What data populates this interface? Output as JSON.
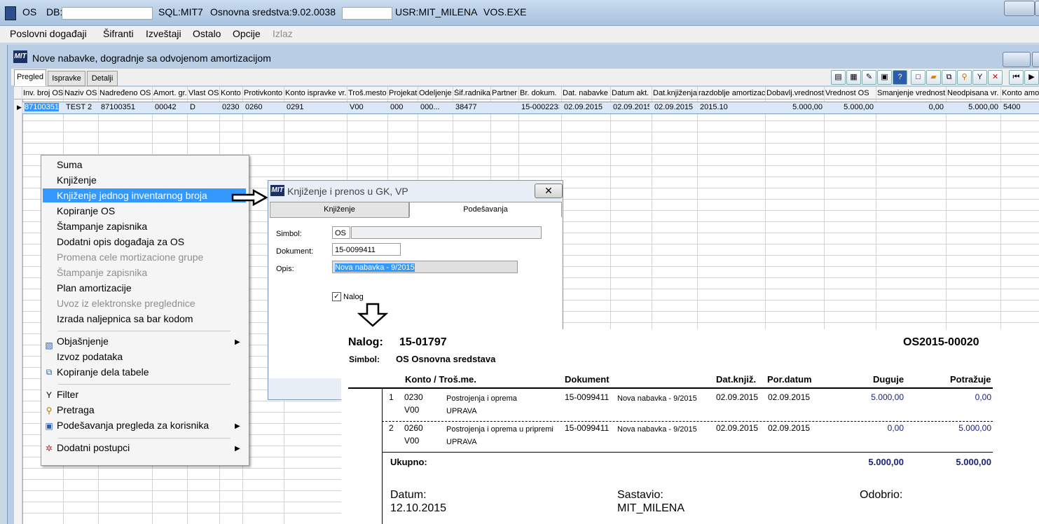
{
  "titlebar": {
    "app": "OS",
    "db_label": "DB:",
    "sql": "SQL:MIT7",
    "version": "Osnovna sredstva:9.02.0038",
    "user": "USR:MIT_MILENA",
    "exe": "VOS.EXE"
  },
  "menu": [
    "Poslovni događaji",
    "Šifranti",
    "Izveštaji",
    "Ostalo",
    "Opcije",
    "Izlaz"
  ],
  "window": {
    "logo": "MIT",
    "title": "Nove nabavke, dogradnje sa odvojenom amortizacijom"
  },
  "tabs": [
    "Pregled",
    "Ispravke",
    "Detalji"
  ],
  "grid": {
    "columns": [
      "Inv. broj OS",
      "Naziv OS",
      "Nadređeno OS",
      "Amort. gr.",
      "Vlast OS",
      "Konto",
      "Protivkonto",
      "Konto ispravke vr.",
      "Troš.mesto",
      "Projekat",
      "Odeljenje",
      "Šif.radnika",
      "Partner",
      "Br. dokum.",
      "Dat. nabavke",
      "Datum akt.",
      "Dat.knjiženja",
      "razdoblje amortizac",
      "Dobavlj.vrednost",
      "Vrednost OS",
      "Smanjenje vrednosti",
      "Neodpisana vr.",
      "Konto amo"
    ],
    "row": [
      "87100351",
      "TEST 2",
      "87100351",
      "00042",
      "D",
      "0230",
      "0260",
      "0291",
      "V00",
      "000",
      "000...",
      "38477",
      "",
      "15-0002233",
      "02.09.2015",
      "02.09.2015",
      "02.09.2015",
      "2015.10",
      "5.000,00",
      "5.000,00",
      "0,00",
      "5.000,00",
      "5400"
    ]
  },
  "context_menu": {
    "items": [
      {
        "label": "Suma",
        "disabled": false
      },
      {
        "label": "Knjiženje",
        "disabled": false
      },
      {
        "label": "Knjiženje jednog inventarnog broja",
        "disabled": false,
        "highlighted": true
      },
      {
        "label": "Kopiranje OS",
        "disabled": false
      },
      {
        "label": "Štampanje zapisnika",
        "disabled": false
      },
      {
        "label": "Dodatni opis događaja za OS",
        "disabled": false
      },
      {
        "label": "Promena cele mortizacione grupe",
        "disabled": true
      },
      {
        "label": "Štampanje zapisnika",
        "disabled": true
      },
      {
        "label": "Plan amortizacije",
        "disabled": false
      },
      {
        "label": "Uvoz iz elektronske preglednice",
        "disabled": true
      },
      {
        "label": "Izrada naljepnica sa bar kodom",
        "disabled": false
      },
      {
        "label": "Objašnjenje",
        "disabled": false,
        "submenu": true,
        "icon": "help-icon"
      },
      {
        "label": "Izvoz podataka",
        "disabled": false
      },
      {
        "label": "Kopiranje dela tabele",
        "disabled": false,
        "icon": "copy-icon"
      },
      {
        "label": "Filter",
        "disabled": false,
        "icon": "filter-icon"
      },
      {
        "label": "Pretraga",
        "disabled": false,
        "icon": "search-icon"
      },
      {
        "label": "Podešavanja pregleda za korisnika",
        "disabled": false,
        "submenu": true,
        "icon": "settings-icon"
      },
      {
        "label": "Dodatni postupci",
        "disabled": false,
        "submenu": true,
        "icon": "gear-icon"
      }
    ]
  },
  "dialog": {
    "logo": "MIT",
    "title": "Knjiženje i prenos u GK, VP",
    "tabs": [
      "Knjiženje",
      "Podešavanja"
    ],
    "simbol_label": "Simbol:",
    "simbol_value": "OS",
    "dokument_label": "Dokument:",
    "dokument_value": "15-0099411",
    "opis_label": "Opis:",
    "opis_value": "Nova nabavka - 9/2015",
    "nalog_label": "Nalog",
    "nalog_checked": true
  },
  "report": {
    "nalog_label": "Nalog:",
    "nalog_number": "15-01797",
    "doc_code": "OS2015-00020",
    "simbol_label": "Simbol:",
    "simbol_value": "OS  Osnovna sredstava",
    "headers": {
      "konto": "Konto  /  Troš.me.",
      "dokument": "Dokument",
      "dat_knjiz": "Dat.knjiž.",
      "por_datum": "Por.datum",
      "duguje": "Duguje",
      "potrazuje": "Potražuje"
    },
    "rows": [
      {
        "no": "1",
        "konto": "0230",
        "tros": "V00",
        "desc": "Postrojenja i oprema",
        "desc2": "UPRAVA",
        "doc": "15-0099411",
        "doc_desc": "Nova nabavka - 9/2015",
        "dat": "02.09.2015",
        "por": "02.09.2015",
        "duguje": "5.000,00",
        "potrazuje": "0,00"
      },
      {
        "no": "2",
        "konto": "0260",
        "tros": "V00",
        "desc": "Postrojenja i oprema u pripremi",
        "desc2": "UPRAVA",
        "doc": "15-0099411",
        "doc_desc": "Nova nabavka - 9/2015",
        "dat": "02.09.2015",
        "por": "02.09.2015",
        "duguje": "0,00",
        "potrazuje": "5.000,00"
      }
    ],
    "total_label": "Ukupno:",
    "total_duguje": "5.000,00",
    "total_potrazuje": "5.000,00",
    "datum_label": "Datum:",
    "datum_value": "12.10.2015",
    "sastavio_label": "Sastavio:",
    "sastavio_value": "MIT_MILENA",
    "odobrio_label": "Odobrio:"
  }
}
